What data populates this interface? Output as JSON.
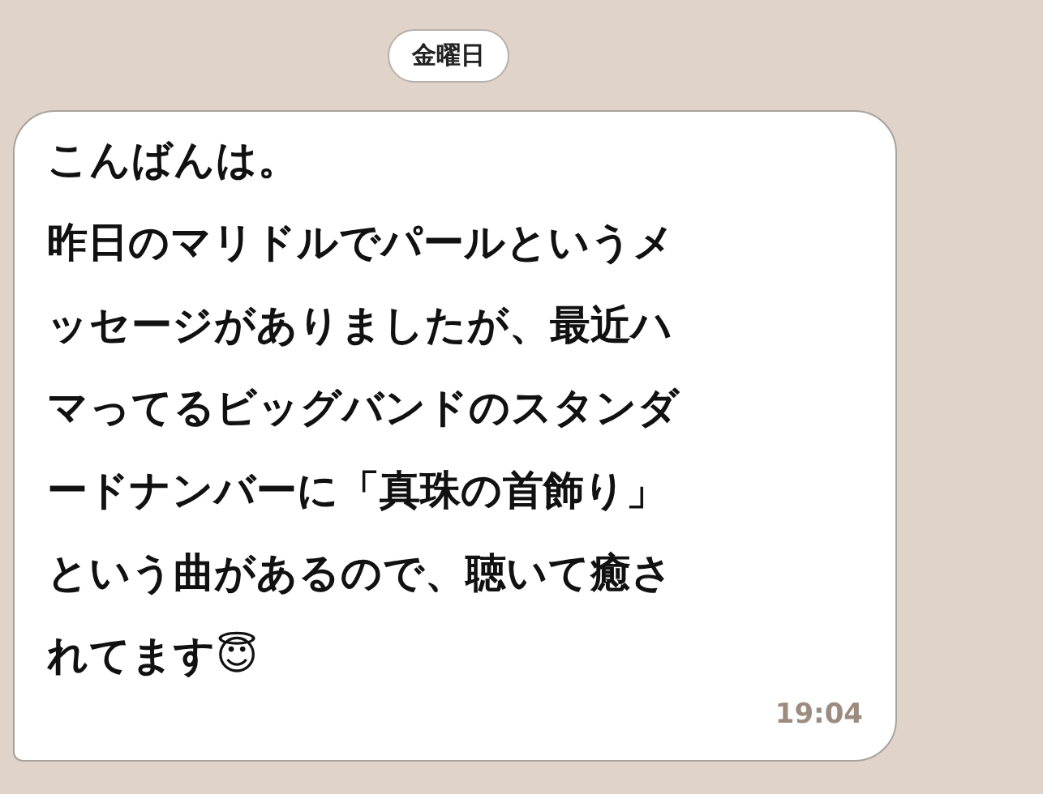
{
  "date_label": "金曜日",
  "message": {
    "lines": [
      "こんばんは。",
      "昨日のマリドルでパールというメ",
      "ッセージがありましたが、最近ハ",
      "マってるビッグバンドのスタンダ",
      "ードナンバーに「真珠の首飾り」",
      "という曲があるので、聴いて癒さ",
      "れてます😇"
    ],
    "time": "19:04"
  }
}
